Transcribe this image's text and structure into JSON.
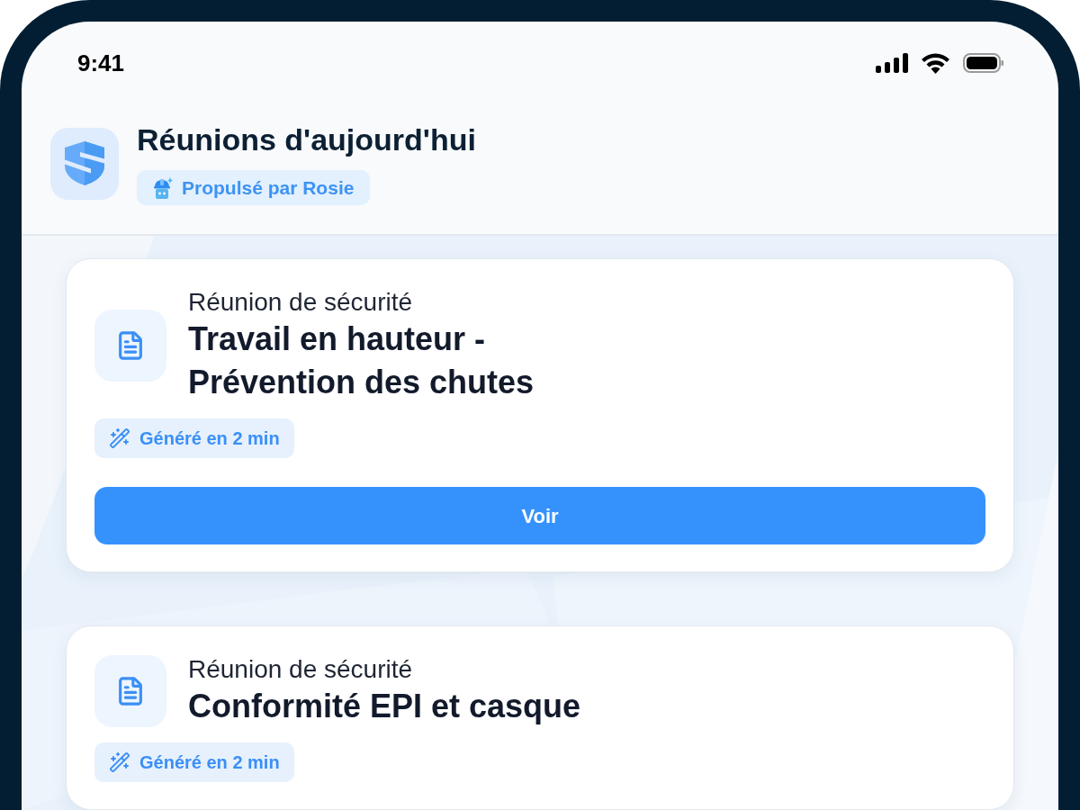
{
  "status_bar": {
    "time": "9:41"
  },
  "header": {
    "title": "Réunions d'aujourd'hui",
    "badge": "Propulsé par Rosie"
  },
  "meetings": [
    {
      "category": "Réunion de sécurité",
      "title": "Travail en hauteur - Prévention des chutes",
      "badge": "Généré en 2 min",
      "button": "Voir"
    },
    {
      "category": "Réunion de sécurité",
      "title": "Conformité EPI et casque",
      "badge": "Généré en 2 min"
    }
  ]
}
